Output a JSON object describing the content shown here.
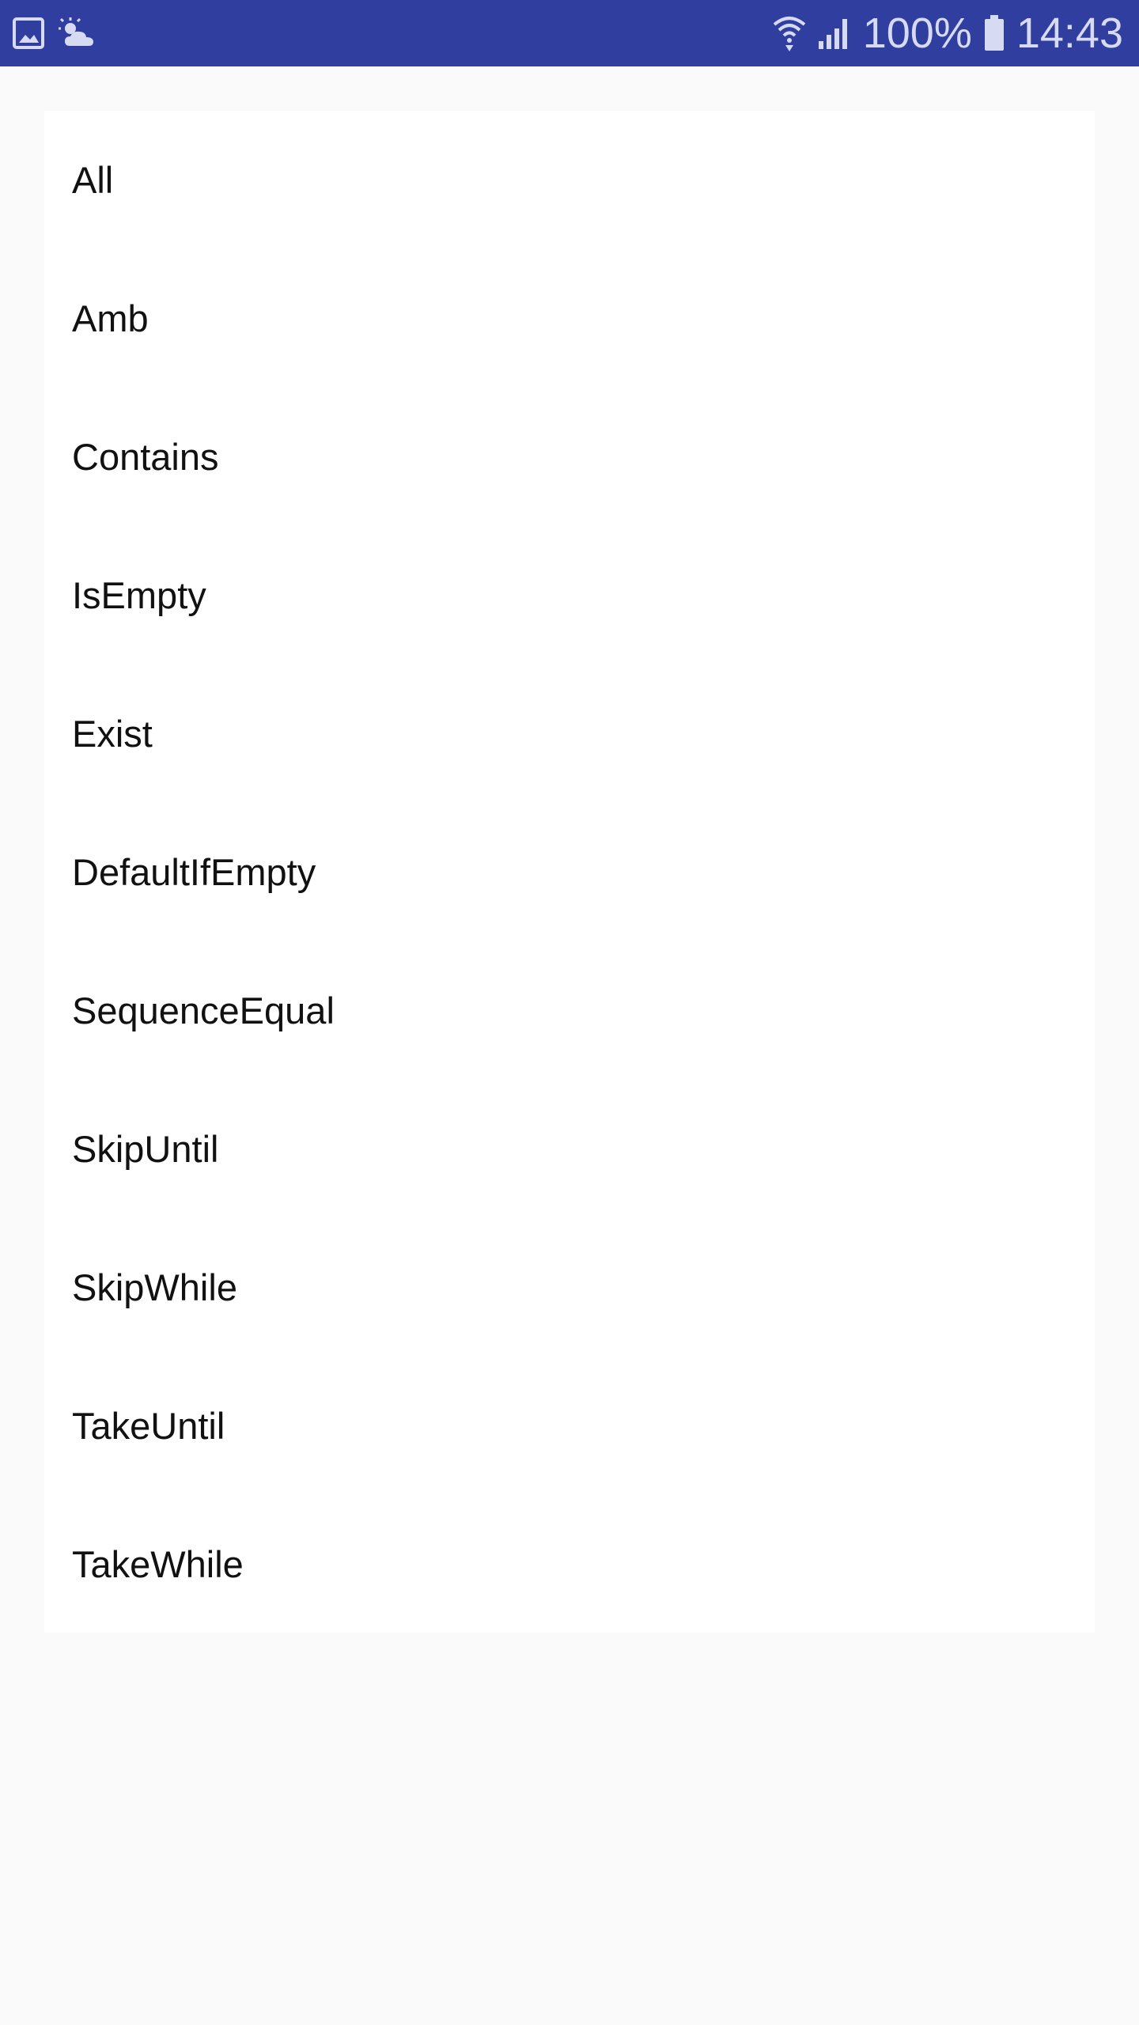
{
  "status_bar": {
    "left_icons": [
      "image-notification-icon",
      "weather-icon"
    ],
    "battery": "100%",
    "time": "14:43",
    "right_icons": [
      "wifi-icon",
      "signal-icon",
      "battery-icon"
    ]
  },
  "list": {
    "items": [
      {
        "label": "All"
      },
      {
        "label": "Amb"
      },
      {
        "label": "Contains"
      },
      {
        "label": "IsEmpty"
      },
      {
        "label": "Exist"
      },
      {
        "label": "DefaultIfEmpty"
      },
      {
        "label": "SequenceEqual"
      },
      {
        "label": "SkipUntil"
      },
      {
        "label": "SkipWhile"
      },
      {
        "label": "TakeUntil"
      },
      {
        "label": "TakeWhile"
      }
    ]
  },
  "colors": {
    "status_bar": "#303f9f",
    "background": "#fafafa",
    "card": "#ffffff",
    "text": "#111111"
  }
}
